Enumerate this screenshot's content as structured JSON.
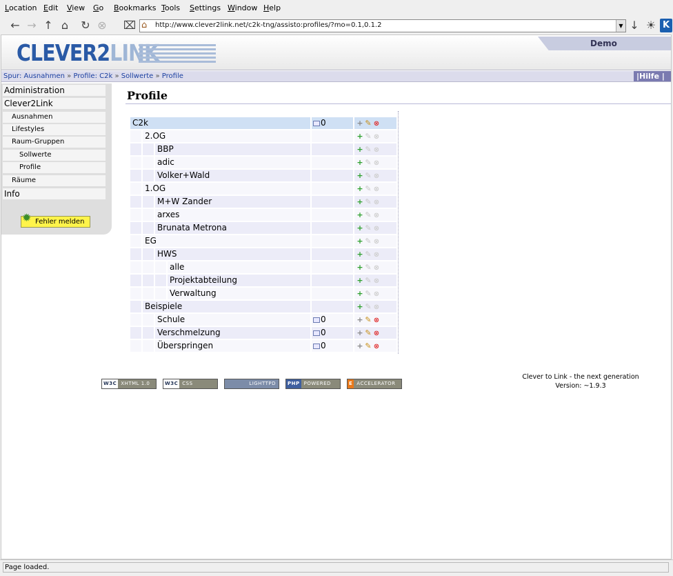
{
  "menu": [
    "Location",
    "Edit",
    "View",
    "Go",
    "Bookmarks",
    "Tools",
    "Settings",
    "Window",
    "Help"
  ],
  "toolbar": {
    "url": "http://www.clever2link.net/c2k-tng/assisto:profiles/?mo=0.1,0.1.2",
    "icons": [
      "back-icon",
      "forward-icon",
      "up-icon",
      "home-icon",
      "reload-icon",
      "stop-icon",
      "clear-location-icon",
      "bookmark-icon",
      "konqueror-icon"
    ]
  },
  "header": {
    "logo_text": "CLEVER2",
    "logo_text_light": "LINK",
    "demo_tab": "Demo"
  },
  "breadcrumb": {
    "prefix": "Spur:",
    "items": [
      "Ausnahmen",
      "Profile: C2k",
      "Sollwerte",
      "Profile"
    ],
    "separator": "»",
    "help": "Hilfe"
  },
  "sidebar": {
    "items": [
      {
        "label": "Administration",
        "level": 1
      },
      {
        "label": "Clever2Link",
        "level": 1
      },
      {
        "label": "Ausnahmen",
        "level": 2
      },
      {
        "label": "Lifestyles",
        "level": 2
      },
      {
        "label": "Raum-Gruppen",
        "level": 2
      },
      {
        "label": "Sollwerte",
        "level": 3
      },
      {
        "label": "Profile",
        "level": 3
      },
      {
        "label": "Räume",
        "level": 2
      },
      {
        "label": "Info",
        "level": 1
      }
    ],
    "bug_button": "Fehler melden"
  },
  "main": {
    "title": "Profile",
    "rows": [
      {
        "name": "C2k",
        "depth": 0,
        "value": "0",
        "active": true
      },
      {
        "name": "2.OG",
        "depth": 1,
        "value": "",
        "active": false
      },
      {
        "name": "BBP",
        "depth": 2,
        "value": "",
        "active": false
      },
      {
        "name": "adic",
        "depth": 2,
        "value": "",
        "active": false
      },
      {
        "name": "Volker+Wald",
        "depth": 2,
        "value": "",
        "active": false
      },
      {
        "name": "1.OG",
        "depth": 1,
        "value": "",
        "active": false
      },
      {
        "name": "M+W Zander",
        "depth": 2,
        "value": "",
        "active": false
      },
      {
        "name": "arxes",
        "depth": 2,
        "value": "",
        "active": false
      },
      {
        "name": "Brunata Metrona",
        "depth": 2,
        "value": "",
        "active": false
      },
      {
        "name": "EG",
        "depth": 1,
        "value": "",
        "active": false
      },
      {
        "name": "HWS",
        "depth": 2,
        "value": "",
        "active": false
      },
      {
        "name": "alle",
        "depth": 3,
        "value": "",
        "active": false
      },
      {
        "name": "Projektabteilung",
        "depth": 3,
        "value": "",
        "active": false
      },
      {
        "name": "Verwaltung",
        "depth": 3,
        "value": "",
        "active": false
      },
      {
        "name": "Beispiele",
        "depth": 1,
        "value": "",
        "active": false
      },
      {
        "name": "Schule",
        "depth": 2,
        "value": "0",
        "active": true
      },
      {
        "name": "Verschmelzung",
        "depth": 2,
        "value": "0",
        "active": true
      },
      {
        "name": "Überspringen",
        "depth": 2,
        "value": "0",
        "active": true
      }
    ]
  },
  "footer": {
    "badges": [
      {
        "pre": "W3C",
        "text": "XHTML 1.0"
      },
      {
        "pre": "W3C",
        "text": "CSS"
      },
      {
        "pre": "",
        "text": "LIGHTTPD"
      },
      {
        "pre": "PHP",
        "text": "POWERED"
      },
      {
        "pre": "E",
        "text": "ACCELERATOR"
      }
    ],
    "tagline": "Clever to Link - the next generation",
    "version": "Version: ~1.9.3"
  },
  "status": "Page loaded.",
  "colors": {
    "accent": "#2a5aa6",
    "row_selected": "#cfe0f4",
    "row_odd": "#ececf8",
    "row_even": "#f7f7fc",
    "help_bg": "#7a7ab0"
  }
}
